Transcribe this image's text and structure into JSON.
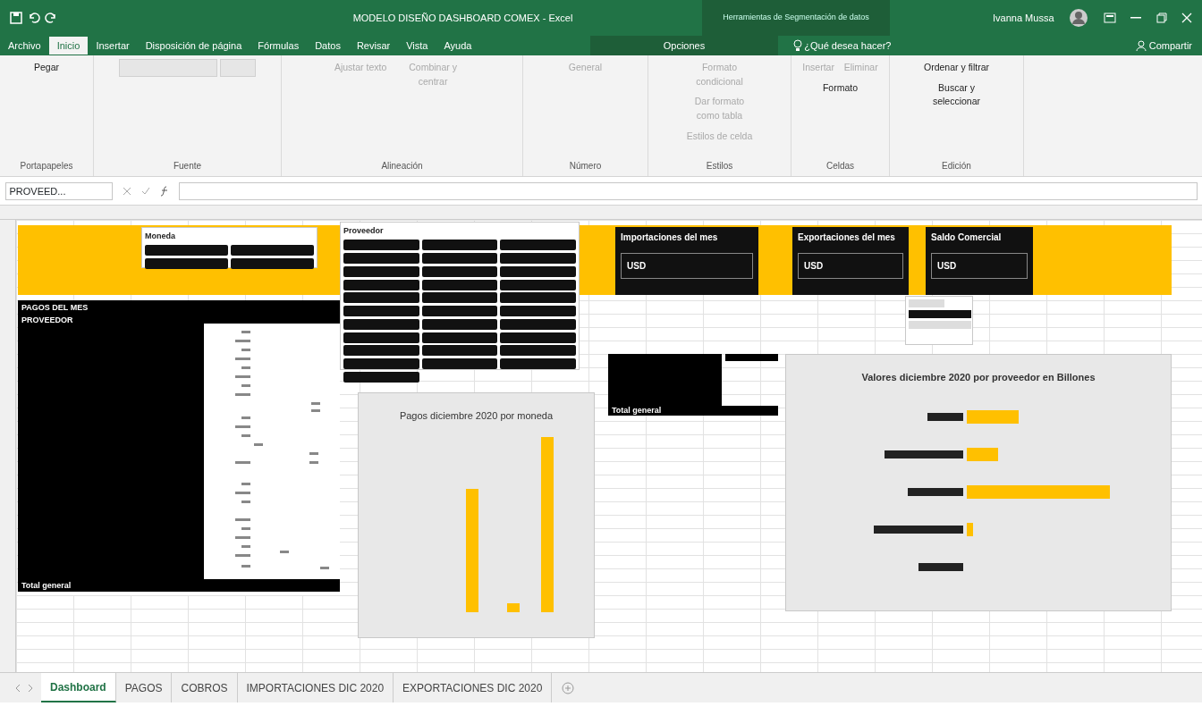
{
  "window": {
    "title": "MODELO DISEÑO DASHBOARD COMEX  -  Excel",
    "context_group": "Herramientas de Segmentación de datos",
    "user": "Ivanna Mussa"
  },
  "ribbon_tabs": [
    {
      "label": "Archivo",
      "selected": false
    },
    {
      "label": "Inicio",
      "selected": true
    },
    {
      "label": "Insertar",
      "selected": false
    },
    {
      "label": "Disposición de página",
      "selected": false
    },
    {
      "label": "Fórmulas",
      "selected": false
    },
    {
      "label": "Datos",
      "selected": false
    },
    {
      "label": "Revisar",
      "selected": false
    },
    {
      "label": "Vista",
      "selected": false
    },
    {
      "label": "Ayuda",
      "selected": false
    }
  ],
  "context_tab": {
    "label": "Opciones"
  },
  "tell_me": "¿Qué desea hacer?",
  "share": "Compartir",
  "ribbon_groups": [
    {
      "label": "Portapapeles",
      "buttons": [
        {
          "label": "Pegar",
          "disabled": false
        }
      ]
    },
    {
      "label": "Fuente"
    },
    {
      "label": "Alineación",
      "buttons": [
        {
          "label": "Ajustar texto",
          "disabled": true
        },
        {
          "label": "Combinar y centrar",
          "disabled": true
        }
      ]
    },
    {
      "label": "Número",
      "buttons": [
        {
          "label": "General",
          "disabled": true
        }
      ]
    },
    {
      "label": "Estilos",
      "buttons": [
        {
          "label": "Formato condicional",
          "disabled": true
        },
        {
          "label": "Dar formato como tabla",
          "disabled": true
        },
        {
          "label": "Estilos de celda",
          "disabled": true
        }
      ]
    },
    {
      "label": "Celdas",
      "buttons": [
        {
          "label": "Insertar",
          "disabled": true
        },
        {
          "label": "Eliminar",
          "disabled": true
        },
        {
          "label": "Formato",
          "disabled": false
        }
      ]
    },
    {
      "label": "Edición",
      "buttons": [
        {
          "label": "Ordenar y filtrar",
          "disabled": false
        },
        {
          "label": "Buscar y seleccionar",
          "disabled": false
        }
      ]
    }
  ],
  "formula_bar": {
    "name_box": "PROVEED..."
  },
  "slicers": [
    {
      "title": "Moneda"
    },
    {
      "title": "Proveedor"
    }
  ],
  "cards": [
    {
      "title": "Importaciones del mes",
      "value": "USD"
    },
    {
      "title": "Exportaciones del mes",
      "value": "USD"
    },
    {
      "title": "Saldo Comercial",
      "value": "USD"
    }
  ],
  "pagos_pivot": {
    "header": "PAGOS DEL MES",
    "row_label": "PROVEEDOR",
    "total": "Total general"
  },
  "summary_pivot": {
    "total": "Total general"
  },
  "charts": [
    {
      "title": "Pagos diciembre 2020 por moneda"
    },
    {
      "title": "Valores diciembre 2020 por proveedor en Billones"
    }
  ],
  "sheet_tabs": [
    {
      "label": "Dashboard",
      "selected": true
    },
    {
      "label": "PAGOS",
      "selected": false
    },
    {
      "label": "COBROS",
      "selected": false
    },
    {
      "label": "IMPORTACIONES DIC 2020",
      "selected": false
    },
    {
      "label": "EXPORTACIONES DIC 2020",
      "selected": false
    }
  ]
}
